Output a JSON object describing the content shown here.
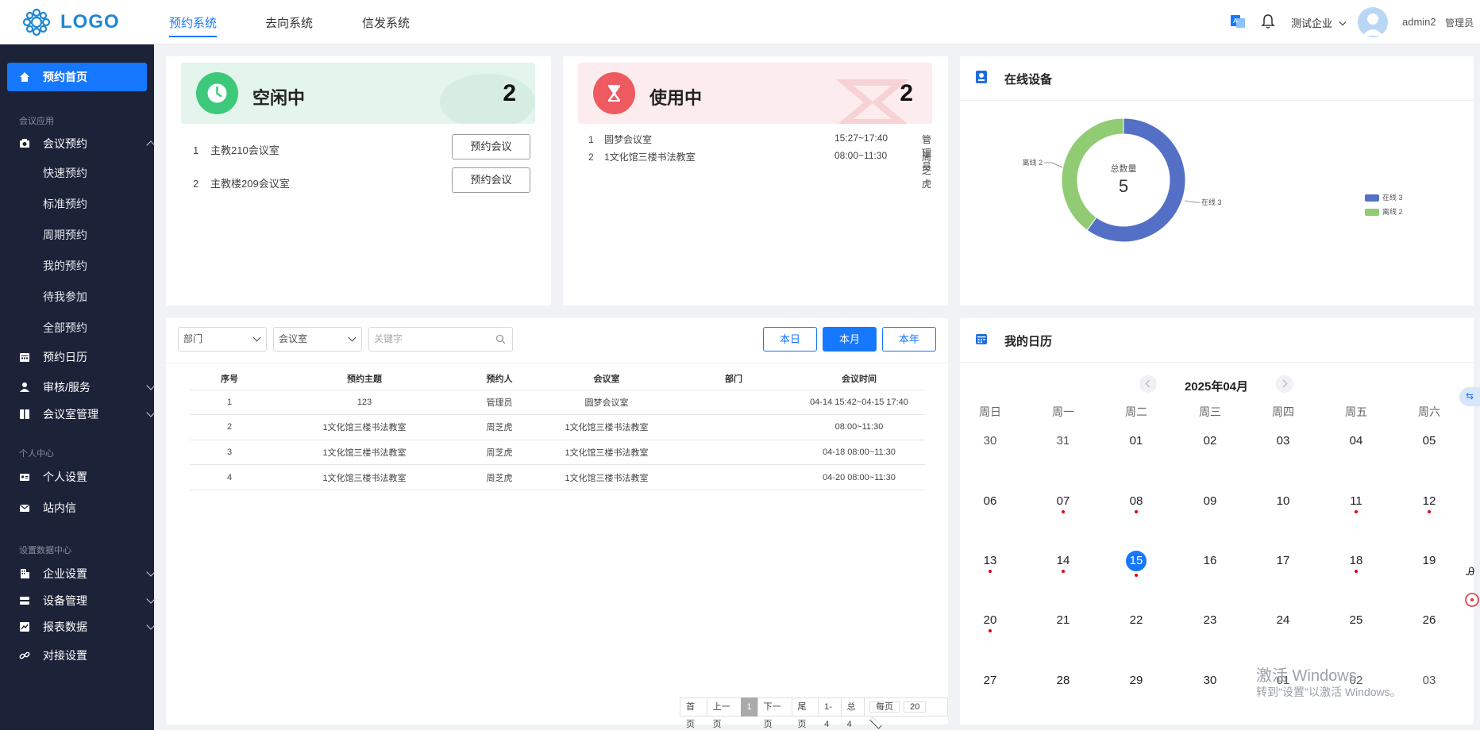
{
  "header": {
    "logo": "LOGO",
    "nav": [
      "预约系统",
      "去向系统",
      "信发系统"
    ],
    "active_nav": "预约系统",
    "company": "测试企业",
    "user": "admin2",
    "role": "管理员"
  },
  "sidebar": {
    "home": "预约首页",
    "group_meeting": "会议应用",
    "meeting_booking": "会议预约",
    "sub": [
      "快速预约",
      "标准预约",
      "周期预约",
      "我的预约",
      "待我参加",
      "全部预约"
    ],
    "calendar": "预约日历",
    "review": "审核/服务",
    "room_mgmt": "会议室管理",
    "group_personal": "个人中心",
    "personal_settings": "个人设置",
    "inbox": "站内信",
    "group_settings": "设置数据中心",
    "enterprise": "企业设置",
    "device": "设备管理",
    "report": "报表数据",
    "integration": "对接设置"
  },
  "idle": {
    "label": "空闲中",
    "count": "2",
    "rows": [
      {
        "num": "1",
        "room": "主教210会议室",
        "btn": "预约会议"
      },
      {
        "num": "2",
        "room": "主教楼209会议室",
        "btn": "预约会议"
      }
    ]
  },
  "inuse": {
    "label": "使用中",
    "count": "2",
    "rows": [
      {
        "num": "1",
        "room": "圆梦会议室",
        "time": "15:27~17:40",
        "who": "管理员"
      },
      {
        "num": "2",
        "room": "1文化馆三楼书法教室",
        "time": "08:00~11:30",
        "who": "周芝虎"
      }
    ]
  },
  "devices": {
    "title": "在线设备",
    "center_label": "总数量",
    "center_value": "5",
    "online_label": "在线 3",
    "offline_label": "离线 2",
    "legend_online": "在线 3",
    "legend_offline": "离线 2",
    "online": 3,
    "offline": 2,
    "color_online": "#5470c6",
    "color_offline": "#91cc75"
  },
  "filters": {
    "dept": "部门",
    "room": "会议室",
    "keyword_placeholder": "关键字",
    "tabs": [
      "本日",
      "本月",
      "本年"
    ],
    "active_tab": "本月"
  },
  "table": {
    "headers": [
      "序号",
      "预约主题",
      "预约人",
      "会议室",
      "部门",
      "会议时间"
    ],
    "rows": [
      [
        "1",
        "123",
        "管理员",
        "圆梦会议室",
        "",
        "04-14 15:42~04-15 17:40"
      ],
      [
        "2",
        "1文化馆三楼书法教室",
        "周芝虎",
        "1文化馆三楼书法教室",
        "",
        "08:00~11:30"
      ],
      [
        "3",
        "1文化馆三楼书法教室",
        "周芝虎",
        "1文化馆三楼书法教室",
        "",
        "04-18 08:00~11:30"
      ],
      [
        "4",
        "1文化馆三楼书法教室",
        "周芝虎",
        "1文化馆三楼书法教室",
        "",
        "04-20 08:00~11:30"
      ]
    ]
  },
  "pager": {
    "first": "首页",
    "prev": "上一页",
    "current": "1",
    "next": "下一页",
    "last": "尾页",
    "range": "1-4",
    "total": "总4",
    "per_page_label": "每页",
    "per_page": "20"
  },
  "calendar": {
    "title": "我的日历",
    "month": "2025年04月",
    "weekdays": [
      "周日",
      "周一",
      "周二",
      "周三",
      "周四",
      "周五",
      "周六"
    ],
    "weeks": [
      [
        "30",
        "31",
        "01",
        "02",
        "03",
        "04",
        "05"
      ],
      [
        "06",
        "07",
        "08",
        "09",
        "10",
        "11",
        "12"
      ],
      [
        "13",
        "14",
        "15",
        "16",
        "17",
        "18",
        "19"
      ],
      [
        "20",
        "21",
        "22",
        "23",
        "24",
        "25",
        "26"
      ],
      [
        "27",
        "28",
        "29",
        "30",
        "01",
        "02",
        "03"
      ]
    ],
    "dots": [
      "07",
      "08",
      "11",
      "12",
      "13",
      "14",
      "15",
      "18",
      "20"
    ],
    "today": "15"
  },
  "watermark": {
    "line1": "激活 Windows",
    "line2": "转到\"设置\"以激活 Windows。"
  }
}
